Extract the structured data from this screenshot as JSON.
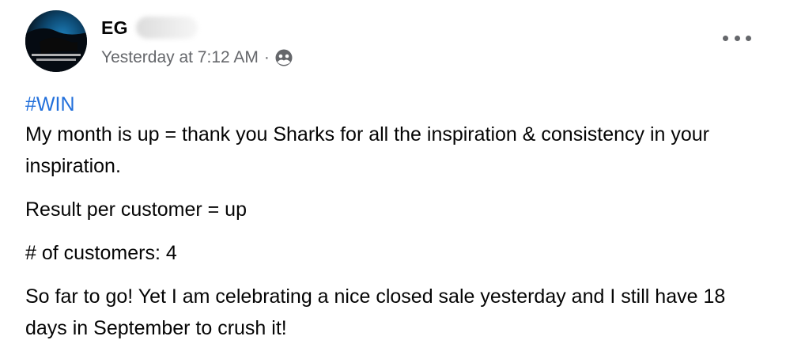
{
  "post": {
    "author_name": "EG",
    "timestamp": "Yesterday at 7:12 AM",
    "separator": "·",
    "audience_icon": "friends-audience-icon",
    "more_icon": "more-options-icon",
    "hashtag": "#WIN",
    "paragraphs": [
      "My month is up = thank you Sharks for all the inspiration & consistency in your inspiration.",
      "Result per customer = up",
      "# of customers: 4",
      "So far to go! Yet I am celebrating a nice closed sale yesterday and I still have 18 days in September to crush it!"
    ]
  },
  "colors": {
    "text": "#050505",
    "secondary_text": "#65676b",
    "link": "#216fdb",
    "background": "#ffffff"
  }
}
